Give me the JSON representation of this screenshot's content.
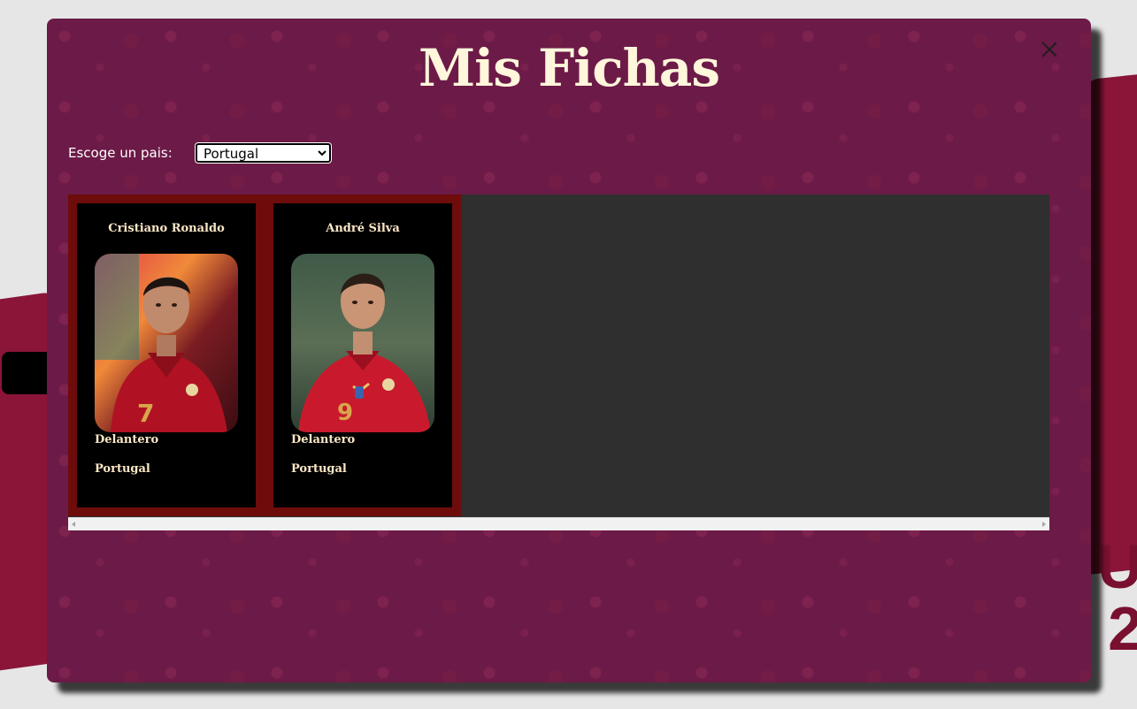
{
  "modal": {
    "title": "Mis Fichas",
    "close_icon": "close-icon"
  },
  "filter": {
    "label": "Escoge un pais:",
    "selected": "Portugal",
    "options": [
      "Portugal"
    ]
  },
  "cards": [
    {
      "name": "Cristiano Ronaldo",
      "position": "Delantero",
      "country": "Portugal",
      "photo": "player-photo",
      "number": "7"
    },
    {
      "name": "André Silva",
      "position": "Delantero",
      "country": "Portugal",
      "photo": "player-photo",
      "number": "9"
    }
  ],
  "colors": {
    "modal_bg": "#6c1a47",
    "card_frame": "#6e0c0c",
    "card_bg": "#000000",
    "card_text": "#fbe7c6",
    "title": "#fff6dc",
    "cards_area_bg": "#2f2f2f"
  }
}
